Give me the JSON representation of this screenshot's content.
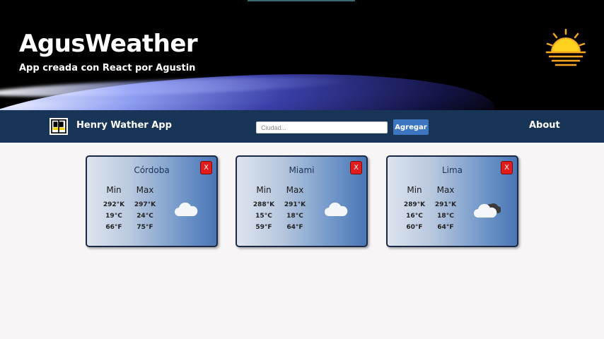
{
  "header": {
    "title": "AgusWeather",
    "subtitle": "App creada con React por Agustin",
    "logo_icon": "sunset-icon"
  },
  "nav": {
    "brand": "Henry Wather App",
    "logo_icon": "app-logo-icon",
    "search_placeholder": "Ciudad...",
    "search_value": "",
    "add_label": "Agregar",
    "about_label": "About"
  },
  "cards": [
    {
      "city": "Córdoba",
      "close_label": "X",
      "min_label": "Min",
      "max_label": "Max",
      "min": {
        "k": "292°K",
        "c": "19°C",
        "f": "66°F"
      },
      "max": {
        "k": "297°K",
        "c": "24°C",
        "f": "75°F"
      },
      "icon": "cloud-icon"
    },
    {
      "city": "Miami",
      "close_label": "X",
      "min_label": "Min",
      "max_label": "Max",
      "min": {
        "k": "288°K",
        "c": "15°C",
        "f": "59°F"
      },
      "max": {
        "k": "291°K",
        "c": "18°C",
        "f": "64°F"
      },
      "icon": "cloud-icon"
    },
    {
      "city": "Lima",
      "close_label": "X",
      "min_label": "Min",
      "max_label": "Max",
      "min": {
        "k": "289°K",
        "c": "16°C",
        "f": "60°F"
      },
      "max": {
        "k": "291°K",
        "c": "18°C",
        "f": "64°F"
      },
      "icon": "broken-clouds-icon"
    }
  ],
  "colors": {
    "navbar": "#183457",
    "add_button": "#3d76c0",
    "close_button": "#e21b1b",
    "page_bg": "#f8f5f6"
  }
}
